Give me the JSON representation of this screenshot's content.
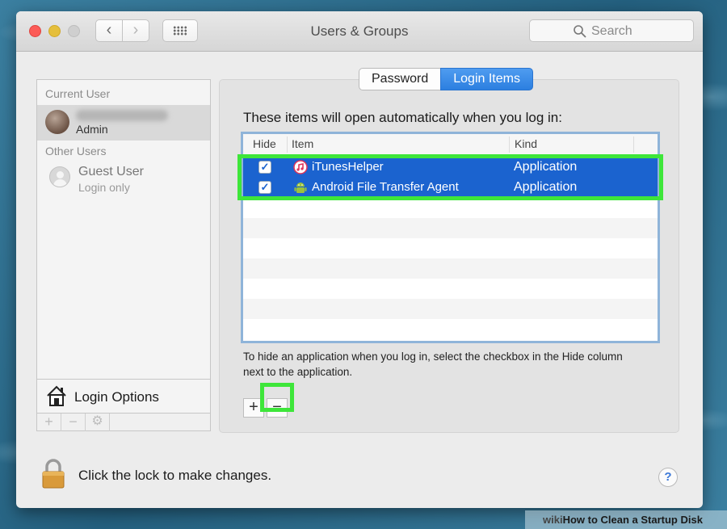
{
  "window": {
    "title": "Users & Groups",
    "search_placeholder": "Search"
  },
  "sidebar": {
    "current_user_header": "Current User",
    "current_user_role": "Admin",
    "other_users_header": "Other Users",
    "guest_name": "Guest User",
    "guest_sub": "Login only",
    "login_options": "Login Options",
    "add_symbol": "+",
    "remove_symbol": "−"
  },
  "tabs": {
    "password": "Password",
    "login_items": "Login Items",
    "selected": "Login Items"
  },
  "main": {
    "intro": "These items will open automatically when you log in:",
    "columns": [
      "Hide",
      "Item",
      "Kind"
    ],
    "items": [
      {
        "hide": true,
        "name": "iTunesHelper",
        "kind": "Application",
        "icon": "itunes-icon"
      },
      {
        "hide": true,
        "name": "Android File Transfer Agent",
        "kind": "Application",
        "icon": "android-icon"
      }
    ],
    "hint": "To hide an application when you log in, select the checkbox in the Hide column next to the application.",
    "add_symbol": "+",
    "remove_symbol": "−"
  },
  "footer": {
    "lock_text": "Click the lock to make changes.",
    "help": "?"
  },
  "watermark": {
    "wiki": "wiki",
    "text": "How to Clean a Startup Disk"
  },
  "colors": {
    "selection": "#1b63cf",
    "highlight": "#3ee63a",
    "tab_active": "#2c7fe0"
  }
}
